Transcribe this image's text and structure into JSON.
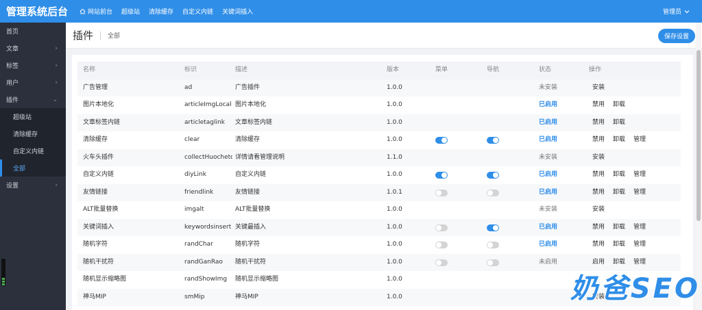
{
  "brand": "管理系统后台",
  "topnav": [
    {
      "label": "网站前台",
      "icon": "home-icon"
    },
    {
      "label": "超级站"
    },
    {
      "label": "清除缓存"
    },
    {
      "label": "自定义内链"
    },
    {
      "label": "关键词插入"
    }
  ],
  "admin": {
    "label": "管理员",
    "icon": "chevron-down-icon"
  },
  "sidebar": {
    "items": [
      {
        "label": "首页"
      },
      {
        "label": "文章",
        "chevron": "›"
      },
      {
        "label": "标签",
        "chevron": "›"
      },
      {
        "label": "用户",
        "chevron": "›"
      },
      {
        "label": "插件",
        "chevron": "⌄"
      }
    ],
    "plugin_sub": [
      "超级站",
      "清除缓存",
      "自定义内链",
      "全部"
    ],
    "settings": {
      "label": "设置",
      "chevron": "›"
    }
  },
  "header": {
    "title": "插件",
    "crumb": "全部",
    "save_label": "保存设置"
  },
  "table": {
    "headers": [
      "名称",
      "标识",
      "描述",
      "版本",
      "菜单",
      "导航",
      "状态",
      "操作"
    ],
    "rows": [
      {
        "name": "广告管理",
        "id": "ad",
        "desc": "广告插件",
        "ver": "1.0.0",
        "menu": null,
        "nav": null,
        "status": "未安装",
        "ops": [
          "安装"
        ]
      },
      {
        "name": "图片本地化",
        "id": "articleImgLocal",
        "desc": "图片本地化",
        "ver": "1.0.0",
        "menu": null,
        "nav": null,
        "status": "已启用",
        "ops": [
          "禁用",
          "卸载"
        ]
      },
      {
        "name": "文章标签内链",
        "id": "articletaglink",
        "desc": "文章标签内链",
        "ver": "1.0.0",
        "menu": null,
        "nav": null,
        "status": "已启用",
        "ops": [
          "禁用",
          "卸载"
        ]
      },
      {
        "name": "清除缓存",
        "id": "clear",
        "desc": "清除缓存",
        "ver": "1.0.0",
        "menu": true,
        "nav": true,
        "status": "已启用",
        "ops": [
          "禁用",
          "卸载",
          "管理"
        ]
      },
      {
        "name": "火车头插件",
        "id": "collectHuochetou",
        "desc": "详情请看管理说明",
        "ver": "1.1.0",
        "menu": null,
        "nav": null,
        "status": "未安装",
        "ops": [
          "安装"
        ]
      },
      {
        "name": "自定义内链",
        "id": "diyLink",
        "desc": "自定义内链",
        "ver": "1.0.0",
        "menu": true,
        "nav": true,
        "status": "已启用",
        "ops": [
          "禁用",
          "卸载",
          "管理"
        ]
      },
      {
        "name": "友情链接",
        "id": "friendlink",
        "desc": "友情链接",
        "ver": "1.0.1",
        "menu": false,
        "nav": false,
        "status": "已启用",
        "ops": [
          "禁用",
          "卸载",
          "管理"
        ]
      },
      {
        "name": "ALT批量替换",
        "id": "imgalt",
        "desc": "ALT批量替换",
        "ver": "1.0.0",
        "menu": null,
        "nav": null,
        "status": "未安装",
        "ops": [
          "安装"
        ]
      },
      {
        "name": "关键词插入",
        "id": "keywordsinsert",
        "desc": "关键最插入",
        "ver": "1.0.0",
        "menu": false,
        "nav": true,
        "status": "已启用",
        "ops": [
          "禁用",
          "卸载",
          "管理"
        ]
      },
      {
        "name": "随机字符",
        "id": "randChar",
        "desc": "随机字符",
        "ver": "1.0.0",
        "menu": false,
        "nav": false,
        "status": "已启用",
        "ops": [
          "禁用",
          "卸载",
          "管理"
        ]
      },
      {
        "name": "随机干扰符",
        "id": "randGanRao",
        "desc": "随机干扰符",
        "ver": "1.0.0",
        "menu": false,
        "nav": false,
        "status": "未启用",
        "ops": [
          "启用",
          "卸载",
          "管理"
        ]
      },
      {
        "name": "随机显示缩略图",
        "id": "randShowImg",
        "desc": "随机显示缩略图",
        "ver": "1.0.0",
        "menu": null,
        "nav": null,
        "status": "",
        "ops": []
      },
      {
        "name": "神马MIP",
        "id": "smMip",
        "desc": "神马MIP",
        "ver": "1.0.0",
        "menu": null,
        "nav": null,
        "status": "",
        "ops": [
          "安装"
        ]
      }
    ]
  },
  "watermark": "奶爸SEO",
  "colors": {
    "accent": "#2f8ee8",
    "sidebar": "#2b303c",
    "submenu": "#20242d"
  }
}
